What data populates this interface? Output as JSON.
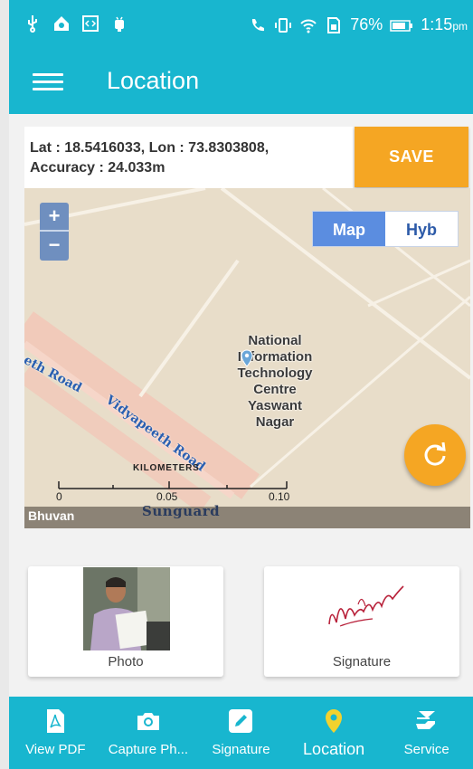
{
  "status_bar": {
    "battery_percent": "76%",
    "time": "1:15",
    "time_suffix": "pm",
    "icons": [
      "usb-icon",
      "home-icon",
      "code-icon",
      "android-icon",
      "phone-icon",
      "vibrate-icon",
      "wifi-icon",
      "sim-icon",
      "battery-icon"
    ]
  },
  "app_bar": {
    "title": "Location",
    "menu_icon": "hamburger-menu-icon"
  },
  "location": {
    "coordinates_line1": "Lat : 18.5416033, Lon : 73.8303808,",
    "coordinates_line2": "Accuracy : 24.033m",
    "save_label": "SAVE"
  },
  "map": {
    "zoom_in": "+",
    "zoom_out": "−",
    "layer_map": "Map",
    "layer_hybrid": "Hyb",
    "place_label": [
      "National",
      "Information",
      "Technology",
      "Centre",
      "Yaswant",
      "Nagar"
    ],
    "road_label_1": "eeth Road",
    "road_label_2": "Vidyapeeth Road",
    "scale_title": "KILOMETERS",
    "scale_ticks": [
      "0",
      "0.05",
      "0.10"
    ],
    "source": "Bhuvan",
    "area_label": "Sunguard",
    "colors": {
      "land": "#e8ddc9",
      "road": "#f0b8a8",
      "accent": "#f5a623",
      "active_toggle": "#5b8de0"
    }
  },
  "cards": {
    "photo_label": "Photo",
    "signature_label": "Signature"
  },
  "bottom_nav": {
    "items": [
      {
        "label": "View PDF",
        "icon": "pdf-icon"
      },
      {
        "label": "Capture Ph...",
        "icon": "camera-icon"
      },
      {
        "label": "Signature",
        "icon": "pencil-icon"
      },
      {
        "label": "Location",
        "icon": "location-pin-icon"
      },
      {
        "label": "Service",
        "icon": "service-icon"
      }
    ],
    "active": "Location"
  },
  "theme": {
    "primary": "#18b6cf",
    "accent": "#f5a623"
  }
}
